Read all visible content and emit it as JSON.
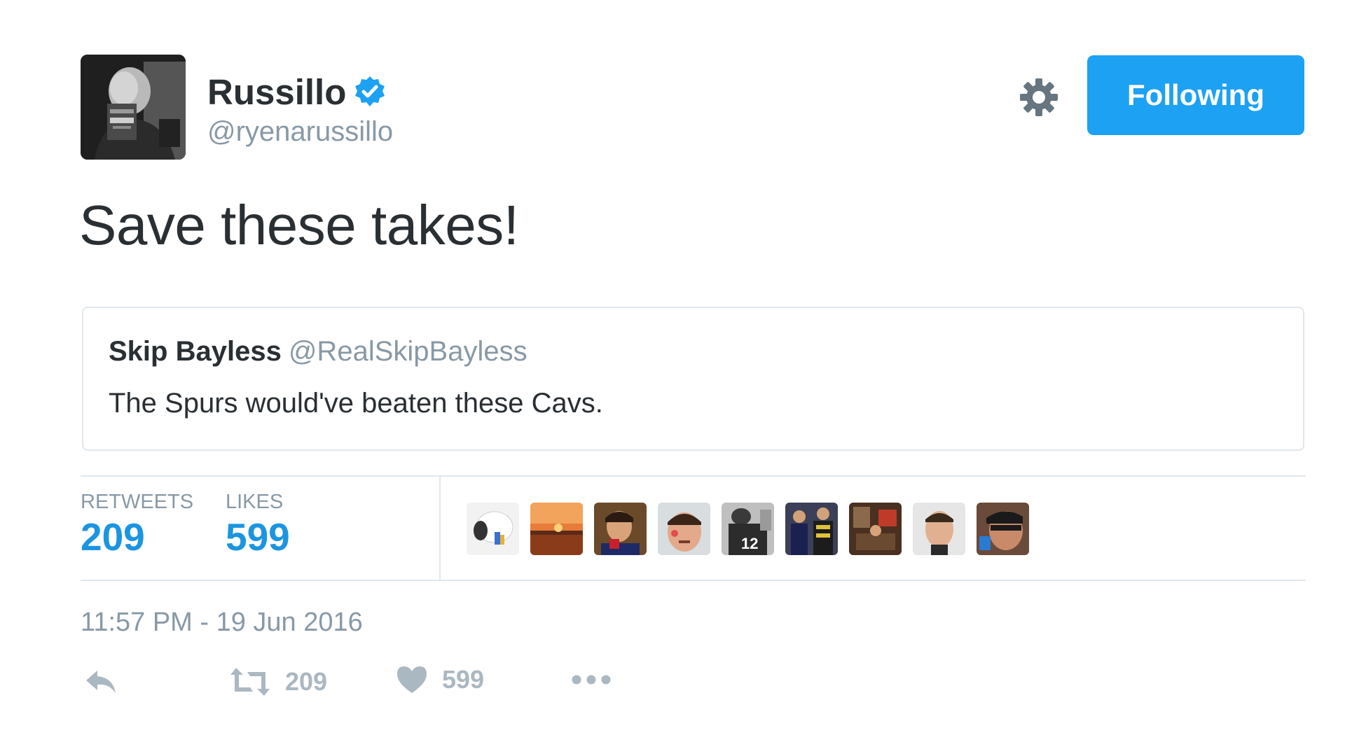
{
  "author": {
    "display_name": "Russillo",
    "screen_name": "@ryenarussillo",
    "verified": true,
    "avatar_icon": "user-photo-avatar"
  },
  "header": {
    "settings_icon": "gear-icon",
    "follow_label": "Following",
    "accent_color": "#1da1f2"
  },
  "tweet": {
    "text": "Save these takes!"
  },
  "quote": {
    "name": "Skip Bayless",
    "handle": "@RealSkipBayless",
    "text": "The Spurs would've beaten these Cavs."
  },
  "stats": {
    "retweets_label": "RETWEETS",
    "retweets_value": "209",
    "likes_label": "LIKES",
    "likes_value": "599",
    "value_color": "#1b95e0"
  },
  "likers": [
    {
      "icon": "liker-avatar"
    },
    {
      "icon": "liker-avatar"
    },
    {
      "icon": "liker-avatar"
    },
    {
      "icon": "liker-avatar"
    },
    {
      "icon": "liker-avatar"
    },
    {
      "icon": "liker-avatar"
    },
    {
      "icon": "liker-avatar"
    },
    {
      "icon": "liker-avatar"
    },
    {
      "icon": "liker-avatar"
    }
  ],
  "timestamp": "11:57 PM - 19 Jun 2016",
  "actions": {
    "reply_icon": "reply-icon",
    "retweet_icon": "retweet-icon",
    "retweet_count": "209",
    "like_icon": "heart-icon",
    "like_count": "599",
    "more_icon": "more-icon"
  }
}
